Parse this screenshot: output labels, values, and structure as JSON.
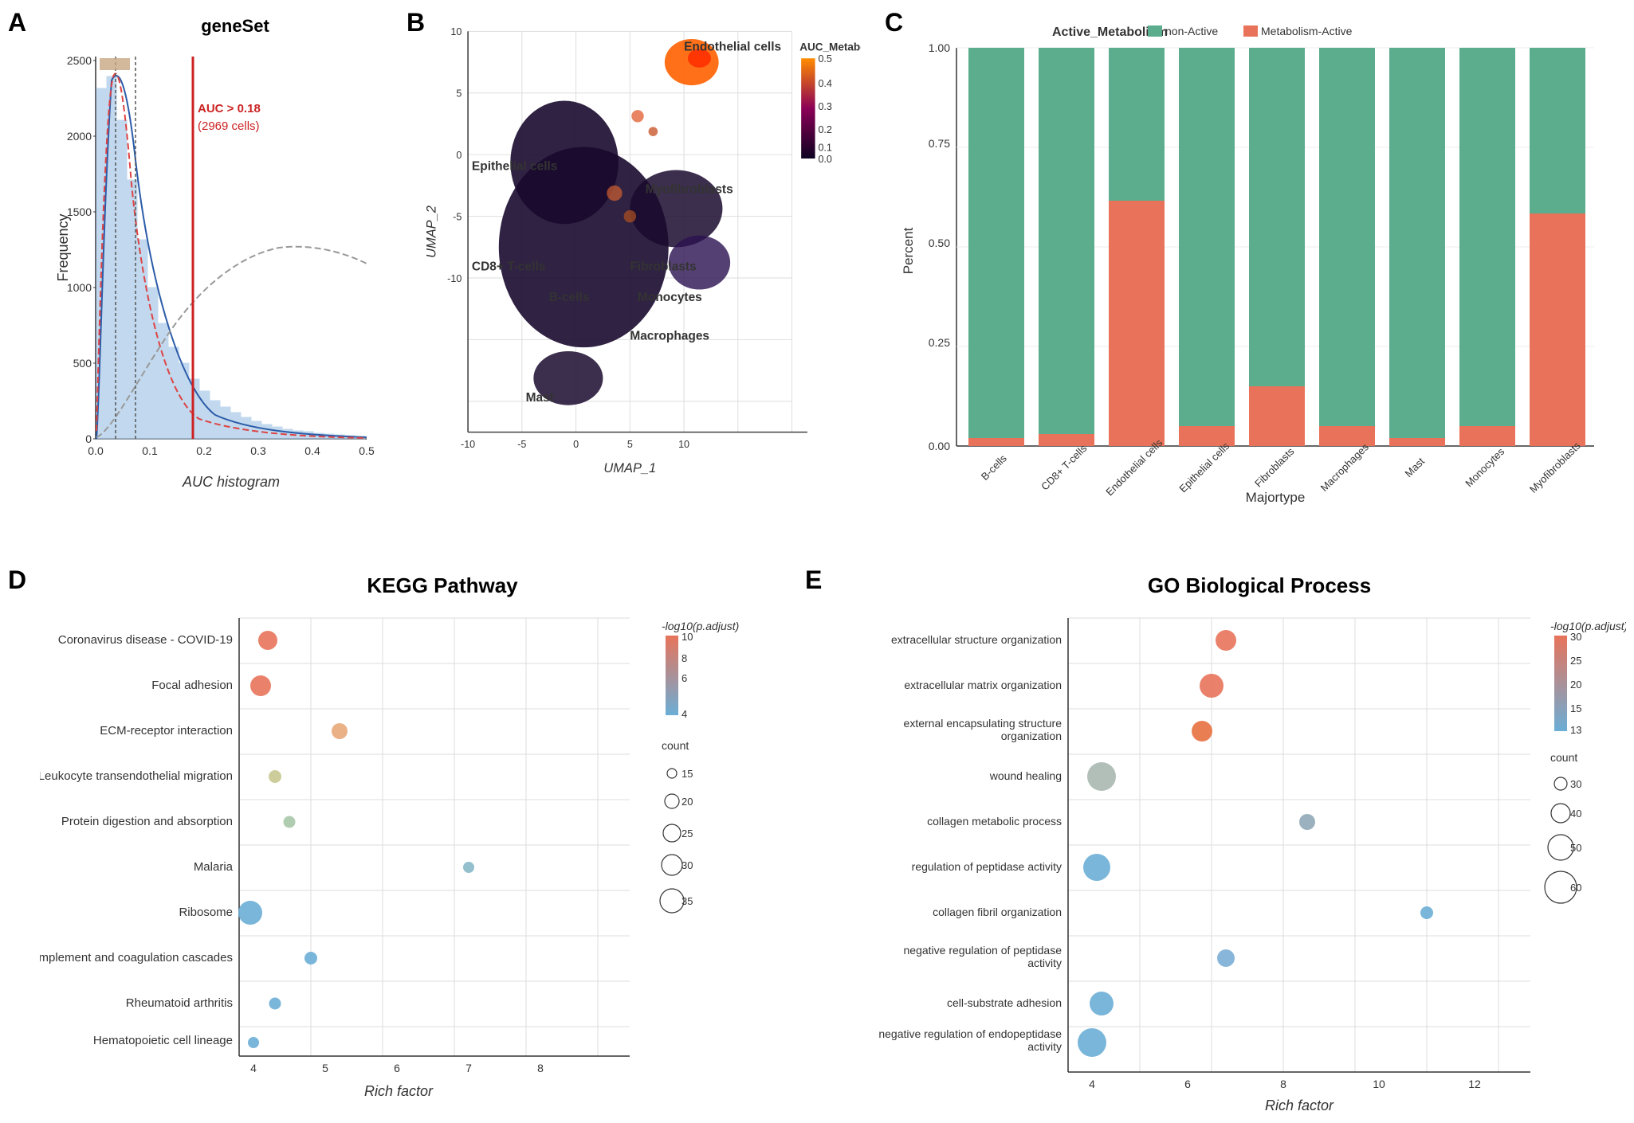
{
  "panels": {
    "a": {
      "label": "A",
      "title": "geneSet",
      "x_axis_label": "AUC histogram",
      "y_axis_label": "Frequency",
      "auc_threshold": 0.18,
      "auc_cells": "2969 cells",
      "auc_text": "AUC > 0.18"
    },
    "b": {
      "label": "B",
      "x_axis_label": "UMAP_1",
      "y_axis_label": "UMAP_2",
      "legend_title": "AUC_Metabolism",
      "cell_labels": [
        "Endothelial cells",
        "Epithelial cells",
        "Myofibroblasts",
        "CD8+ T-cells",
        "B-cells",
        "Fibroblasts",
        "Monocytes",
        "Macrophages",
        "Mast"
      ]
    },
    "c": {
      "label": "C",
      "legend_title": "Active_Metabolism",
      "legend_items": [
        {
          "label": "non-Active",
          "color": "#5BAD8E"
        },
        {
          "label": "Metabolism-Active",
          "color": "#E8735A"
        }
      ],
      "x_axis_label": "Majortype",
      "y_axis_label": "Percent",
      "categories": [
        "B-cells",
        "CD8+ T-cells",
        "Endothelial cells",
        "Epithelial cells",
        "Fibroblasts",
        "Macrophages",
        "Mast",
        "Monocytes",
        "Myofibroblasts"
      ],
      "active_pct": [
        0.02,
        0.03,
        0.62,
        0.05,
        0.15,
        0.05,
        0.02,
        0.05,
        0.58
      ]
    },
    "d": {
      "label": "D",
      "title": "KEGG Pathway",
      "x_axis_label": "Rich factor",
      "y_axis_label": "",
      "pathways": [
        {
          "name": "Coronavirus disease - COVID-19",
          "rich_factor": 4.2,
          "count": 28,
          "log10p": 10.5
        },
        {
          "name": "Focal adhesion",
          "rich_factor": 4.1,
          "count": 30,
          "log10p": 10.0
        },
        {
          "name": "ECM-receptor interaction",
          "rich_factor": 5.2,
          "count": 22,
          "log10p": 8.5
        },
        {
          "name": "Leukocyte transendothelial migration",
          "rich_factor": 4.3,
          "count": 18,
          "log10p": 7.0
        },
        {
          "name": "Protein digestion and absorption",
          "rich_factor": 4.5,
          "count": 17,
          "log10p": 6.5
        },
        {
          "name": "Malaria",
          "rich_factor": 7.0,
          "count": 14,
          "log10p": 6.0
        },
        {
          "name": "Ribosome",
          "rich_factor": 3.95,
          "count": 35,
          "log10p": 5.5
        },
        {
          "name": "Complement and coagulation cascades",
          "rich_factor": 4.8,
          "count": 18,
          "log10p": 5.5
        },
        {
          "name": "Rheumatoid arthritis",
          "rich_factor": 4.3,
          "count": 17,
          "log10p": 5.2
        },
        {
          "name": "Hematopoietic cell lineage",
          "rich_factor": 4.0,
          "count": 16,
          "log10p": 4.8
        }
      ],
      "color_scale": {
        "min": 4,
        "max": 10,
        "low": "#6BAED6",
        "high": "#E8735A"
      },
      "size_scale": {
        "min": 14,
        "max": 35
      }
    },
    "e": {
      "label": "E",
      "title": "GO Biological Process",
      "x_axis_label": "Rich factor",
      "y_axis_label": "",
      "pathways": [
        {
          "name": "extracellular structure organization",
          "rich_factor": 6.8,
          "count": 38,
          "log10p": 33
        },
        {
          "name": "extracellular matrix organization",
          "rich_factor": 6.5,
          "count": 42,
          "log10p": 32
        },
        {
          "name": "external encapsulating structure\norganization",
          "rich_factor": 6.3,
          "count": 38,
          "log10p": 30
        },
        {
          "name": "wound healing",
          "rich_factor": 4.2,
          "count": 50,
          "log10p": 20
        },
        {
          "name": "collagen metabolic process",
          "rich_factor": 8.5,
          "count": 28,
          "log10p": 18
        },
        {
          "name": "regulation of peptidase activity",
          "rich_factor": 4.1,
          "count": 48,
          "log10p": 15
        },
        {
          "name": "collagen fibril organization",
          "rich_factor": 11.0,
          "count": 20,
          "log10p": 14
        },
        {
          "name": "negative regulation of peptidase\nactivity",
          "rich_factor": 6.8,
          "count": 30,
          "log10p": 14
        },
        {
          "name": "cell-substrate adhesion",
          "rich_factor": 4.2,
          "count": 42,
          "log10p": 13
        },
        {
          "name": "negative regulation of endopeptidase\nactivity",
          "rich_factor": 4.0,
          "count": 50,
          "log10p": 13
        }
      ],
      "color_scale": {
        "min": 13,
        "max": 33,
        "low": "#6BAED6",
        "high": "#E8735A"
      },
      "size_scale": {
        "min": 20,
        "max": 60
      }
    }
  }
}
